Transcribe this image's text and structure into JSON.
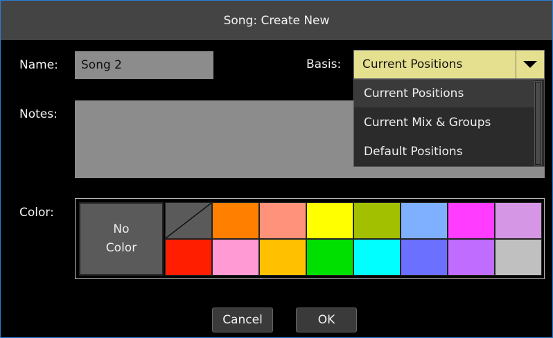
{
  "dialog": {
    "title": "Song: Create New"
  },
  "name": {
    "label": "Name:",
    "value": "Song 2"
  },
  "basis": {
    "label": "Basis:",
    "value": "Current Positions",
    "options": [
      "Current Positions",
      "Current Mix & Groups",
      "Default Positions"
    ],
    "accent": "#e4e08f"
  },
  "notes": {
    "label": "Notes:",
    "value": ""
  },
  "color": {
    "label": "Color:",
    "no_color": {
      "line1": "No",
      "line2": "Color"
    },
    "row1": [
      "#ff7f00",
      "#ff927a",
      "#ffff00",
      "#a2c000",
      "#7fb0ff",
      "#ff3cff",
      "#d596e5"
    ],
    "row2": [
      "#ff1e00",
      "#ff9ad5",
      "#ffc000",
      "#00e000",
      "#00ffff",
      "#6b70ff",
      "#bf6cff",
      "#c0c0c0"
    ]
  },
  "buttons": {
    "cancel": "Cancel",
    "ok": "OK"
  }
}
